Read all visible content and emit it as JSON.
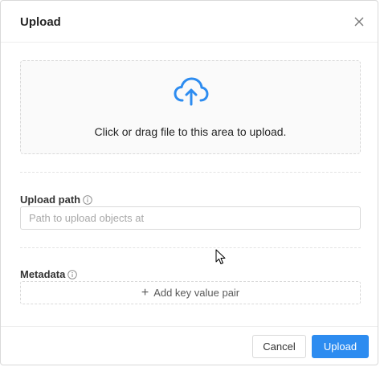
{
  "dialog": {
    "title": "Upload",
    "close_icon": "close-icon"
  },
  "dropzone": {
    "icon": "cloud-upload-icon",
    "text": "Click or drag file to this area to upload."
  },
  "upload_path": {
    "label": "Upload path",
    "info_icon": "info-icon",
    "value": "",
    "placeholder": "Path to upload objects at"
  },
  "metadata": {
    "label": "Metadata",
    "info_icon": "info-icon",
    "add_label": "Add key value pair"
  },
  "footer": {
    "cancel_label": "Cancel",
    "upload_label": "Upload"
  },
  "colors": {
    "accent": "#2d8cf0",
    "border": "#d9d9d9",
    "dropzone_bg": "#fafafa"
  }
}
